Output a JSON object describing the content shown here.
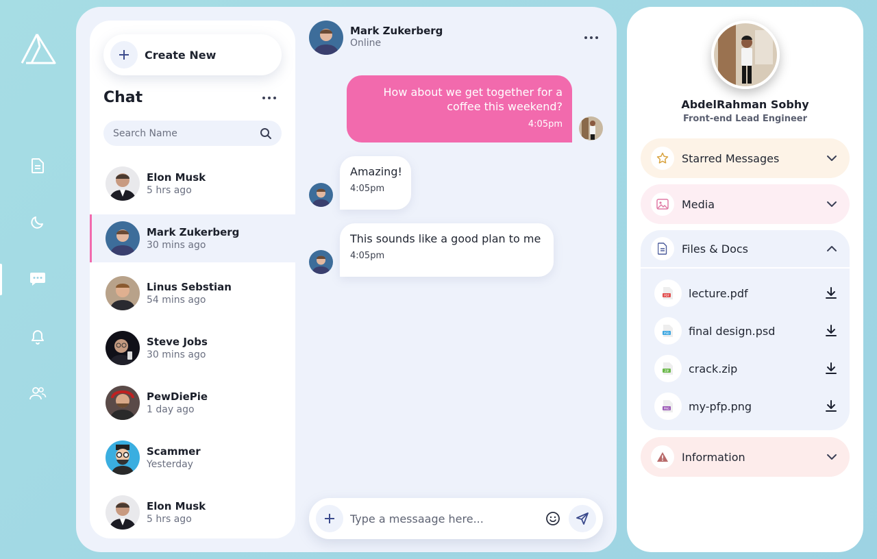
{
  "colors": {
    "background": "#a3d8e3",
    "accent_pink": "#f26aad",
    "panel": "#eef2fb",
    "starred_bg": "#fdf3e7",
    "media_bg": "#fdeef3",
    "information_bg": "#fdeceb"
  },
  "sidebar": {
    "logo_icon": "triangle-logo-icon",
    "items": [
      {
        "icon": "document-icon"
      },
      {
        "icon": "moon-icon"
      },
      {
        "icon": "chat-icon",
        "active": true
      },
      {
        "icon": "bell-icon"
      },
      {
        "icon": "users-icon"
      }
    ]
  },
  "chat_list": {
    "create_label": "Create New",
    "title": "Chat",
    "search_placeholder": "Search Name",
    "contacts": [
      {
        "name": "Elon Musk",
        "time": "5 hrs ago"
      },
      {
        "name": "Mark Zukerberg",
        "time": "30 mins ago",
        "active": true
      },
      {
        "name": "Linus Sebstian",
        "time": "54 mins ago"
      },
      {
        "name": "Steve Jobs",
        "time": "30 mins ago"
      },
      {
        "name": "PewDiePie",
        "time": "1 day ago"
      },
      {
        "name": "Scammer",
        "time": "Yesterday"
      },
      {
        "name": "Elon Musk",
        "time": "5 hrs ago"
      }
    ]
  },
  "conversation": {
    "name": "Mark Zukerberg",
    "status": "Online",
    "messages": [
      {
        "direction": "out",
        "text": "How about we get together for a coffee this weekend?",
        "time": "4:05pm"
      },
      {
        "direction": "in",
        "text": "Amazing!",
        "time": "4:05pm"
      },
      {
        "direction": "in",
        "text": "This sounds like a good plan to me",
        "time": "4:05pm"
      }
    ],
    "composer_placeholder": "Type a messaage here..."
  },
  "profile": {
    "name": "AbdelRahman Sobhy",
    "role": "Front-end Lead Engineer",
    "sections": {
      "starred": "Starred Messages",
      "media": "Media",
      "files": "Files & Docs",
      "information": "Information"
    },
    "files": [
      {
        "name": "lecture.pdf",
        "type": "PDF"
      },
      {
        "name": "final design.psd",
        "type": "PSD"
      },
      {
        "name": "crack.zip",
        "type": "ZIP"
      },
      {
        "name": "my-pfp.png",
        "type": "PNG"
      }
    ]
  }
}
